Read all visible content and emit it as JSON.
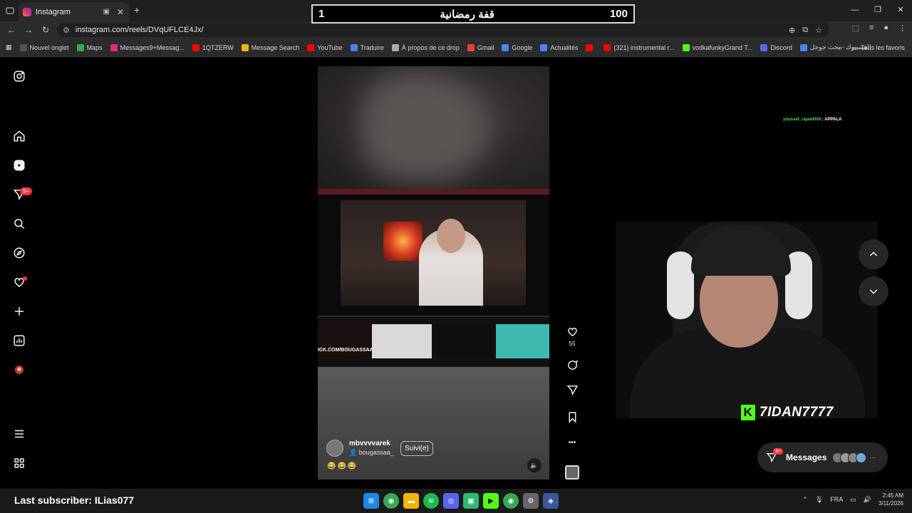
{
  "browser": {
    "tab_title": "Instagram",
    "new_tab_symbol": "+",
    "url": "instagram.com/reels/DVqUFLCE4Jx/",
    "window_controls": [
      "—",
      "❐",
      "✕"
    ]
  },
  "overlay": {
    "score_left": "1",
    "title": "قفة رمضانية",
    "score_right": "100"
  },
  "bookmarks": [
    {
      "label": "Nouvel onglet",
      "color": "#555555"
    },
    {
      "label": "Maps",
      "color": "#34a853"
    },
    {
      "label": "Messages9+Messag...",
      "color": "#dd2a7b"
    },
    {
      "label": "1QTZERW",
      "color": "#ff0000"
    },
    {
      "label": "Message Search",
      "color": "#f4b400"
    },
    {
      "label": "YouTube",
      "color": "#ff0000"
    },
    {
      "label": "Traduire",
      "color": "#4285f4"
    },
    {
      "label": "À propos de ce drop",
      "color": "#aaaaaa"
    },
    {
      "label": "Gmail",
      "color": "#ea4335"
    },
    {
      "label": "Google",
      "color": "#4285f4"
    },
    {
      "label": "Actualités",
      "color": "#4285f4"
    },
    {
      "label": "",
      "color": "#ff0000"
    },
    {
      "label": "(321) instrumental r...",
      "color": "#ff0000"
    },
    {
      "label": "vodkafunkyGrand T...",
      "color": "#53fc18"
    },
    {
      "label": "Discord",
      "color": "#5865f2"
    },
    {
      "label": "الفيسبوك - بحث جوجل",
      "color": "#4285f4"
    }
  ],
  "bookmarks_all": "Tous les favoris",
  "sidenav": {
    "notifications_badge": "9+"
  },
  "reel": {
    "username": "mbvvvvarek",
    "sub_user": "bougassaa_",
    "follow_label": "Suivi(e)",
    "emojis": "😂😂😂",
    "thumb_text": "ICK.COM/BOUGASSAA"
  },
  "actions": {
    "likes": "55",
    "more": "•••"
  },
  "chat": {
    "user": "youssef_rajawi004",
    "sep": " : ",
    "message": "APPALA"
  },
  "cam": {
    "kick_letter": "K",
    "kick_name": "7IDAN7777"
  },
  "messages": {
    "label": "Messages",
    "badge": "9+",
    "more": "···"
  },
  "taskbar": {
    "last_subscriber": "Last subscriber: ILias077",
    "lang": "FRA",
    "time": "2:45 AM",
    "date": "3/11/2026"
  },
  "colors": {
    "accent_red": "#ff3040",
    "kick_green": "#53fc18"
  }
}
